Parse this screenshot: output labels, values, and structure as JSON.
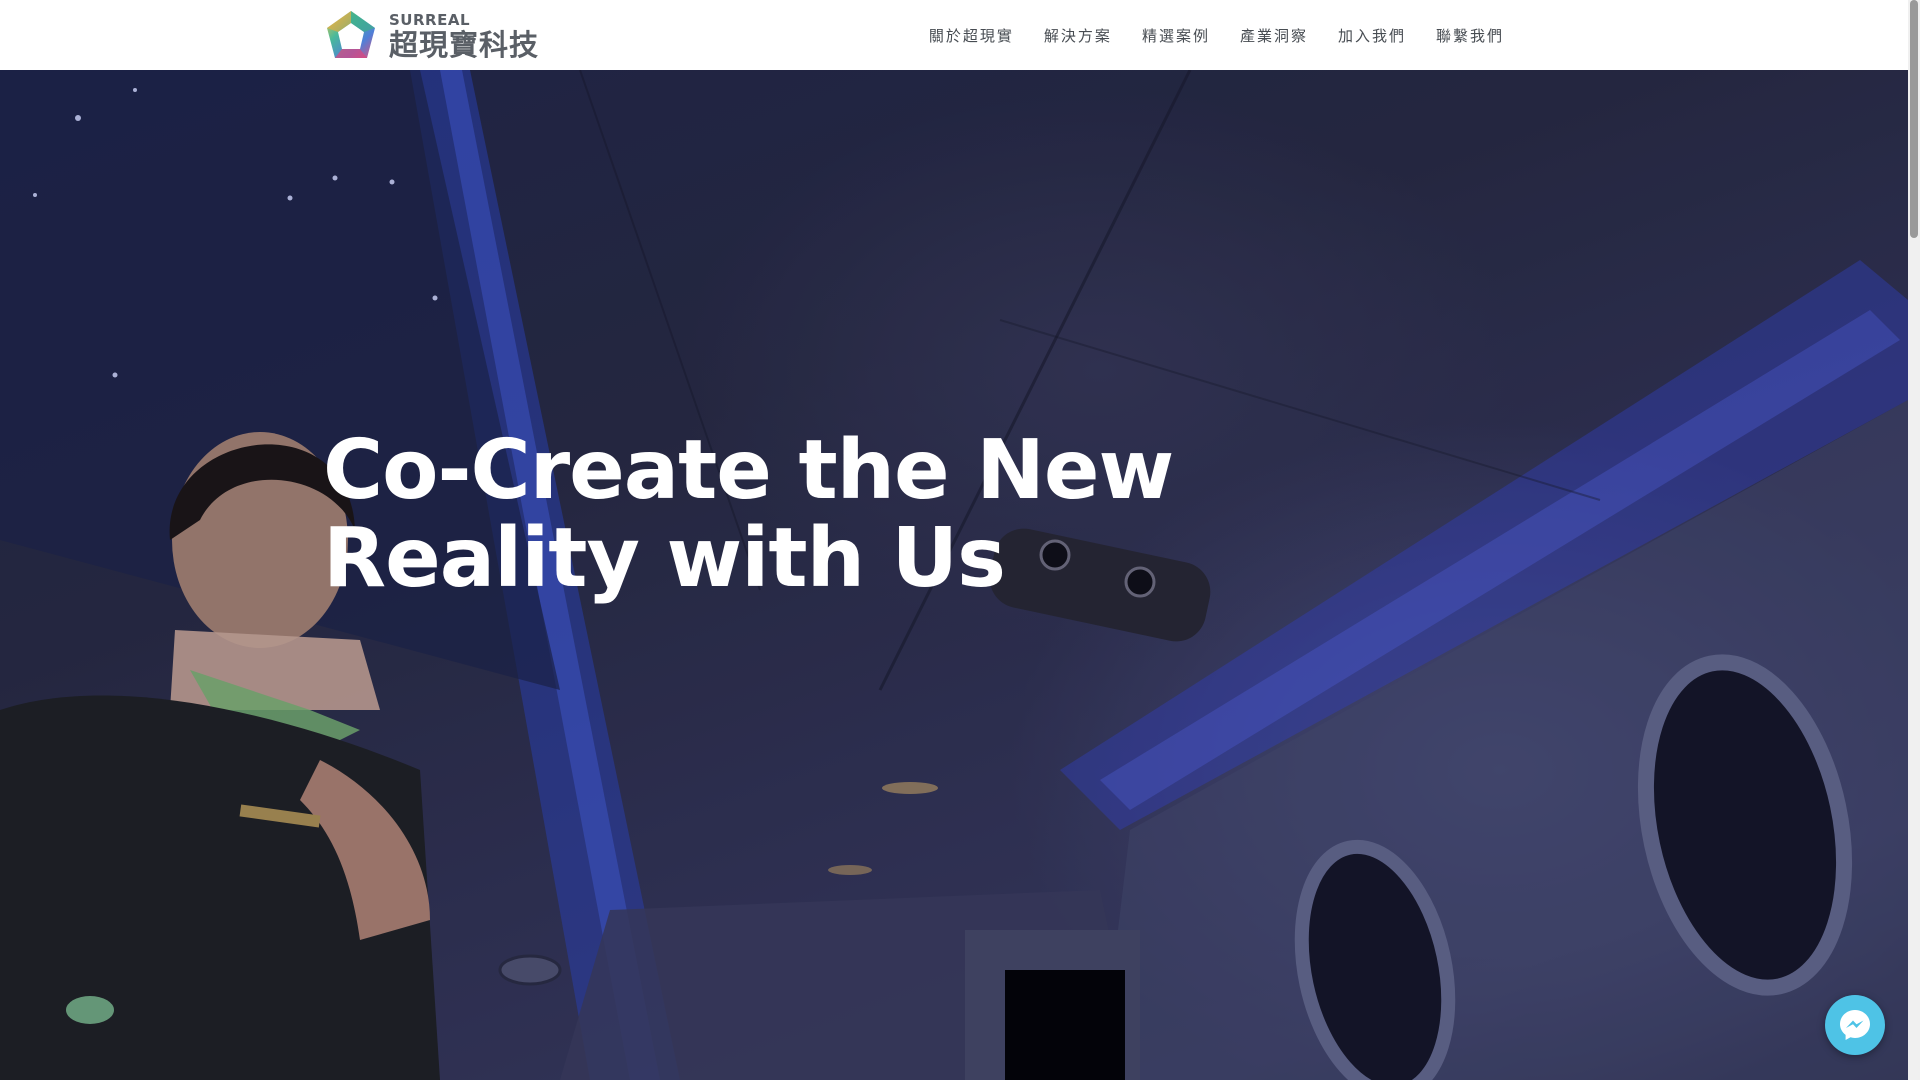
{
  "brand": {
    "name_en": "SURREAL",
    "name_zh": "超現寶科技"
  },
  "nav": {
    "items": [
      {
        "label": "關於超現實"
      },
      {
        "label": "解決方案"
      },
      {
        "label": "精選案例"
      },
      {
        "label": "產業洞察"
      },
      {
        "label": "加入我們"
      },
      {
        "label": "聯繫我們"
      }
    ]
  },
  "hero": {
    "title_line1": "Co-Create the New",
    "title_line2": "Reality with Us",
    "background": "airplane-cabin-scene"
  },
  "chat": {
    "icon": "messenger-icon",
    "color": "#4ec3e6"
  },
  "colors": {
    "header_bg": "#ffffff",
    "nav_text": "#474c52",
    "hero_text": "#ffffff"
  }
}
